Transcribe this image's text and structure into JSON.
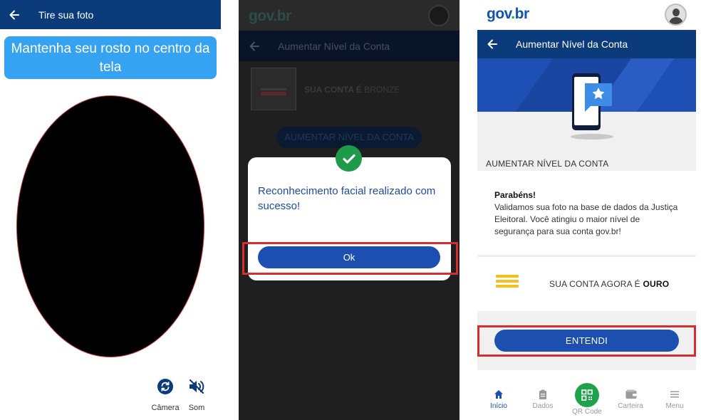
{
  "panel1": {
    "header_title": "Tire sua foto",
    "instruction": "Mantenha seu rosto no centro da tela",
    "tools": {
      "camera_label": "Câmera",
      "sound_label": "Som"
    }
  },
  "panel2": {
    "logo": "gov.br",
    "header_title": "Aumentar Nível da Conta",
    "account_level_prefix": "SUA CONTA É",
    "account_level_value": "BRONZE",
    "raise_level_button": "AUMENTAR NÍVEL DA CONTA",
    "dialog": {
      "message": "Reconhecimento facial realizado com sucesso!",
      "ok_button": "Ok"
    }
  },
  "panel3": {
    "logo_gov": "gov",
    "logo_dot": ".",
    "logo_br": "br",
    "header_title": "Aumentar Nível da Conta",
    "section_title": "AUMENTAR NÍVEL DA CONTA",
    "congrats_title": "Parabéns!",
    "congrats_text": "Validamos sua foto na base de dados da Justiça Eleitoral. Você atingiu o maior nível de segurança para sua conta gov.br!",
    "level_prefix": "SUA CONTA AGORA É",
    "level_value": "OURO",
    "understood_button": "ENTENDI",
    "nav": {
      "inicio": "Início",
      "dados": "Dados",
      "qr_code": "QR Code",
      "carteira": "Carteira",
      "menu": "Menu"
    }
  },
  "colors": {
    "header_blue": "#0b3b7a",
    "button_blue": "#1c4fb0",
    "bubble_blue": "#36a3f2",
    "success_green": "#1fa34a",
    "gold": "#f5c01b",
    "highlight_red": "#d42e2e"
  },
  "icons": {
    "back": "arrow-left-icon",
    "camera_switch": "camera-switch-icon",
    "sound_off": "sound-off-icon",
    "check": "check-icon",
    "star_phone": "phone-star-illustration",
    "home": "home-icon",
    "clipboard": "clipboard-icon",
    "qr": "qr-code-icon",
    "wallet": "wallet-icon",
    "menu": "hamburger-menu-icon"
  }
}
